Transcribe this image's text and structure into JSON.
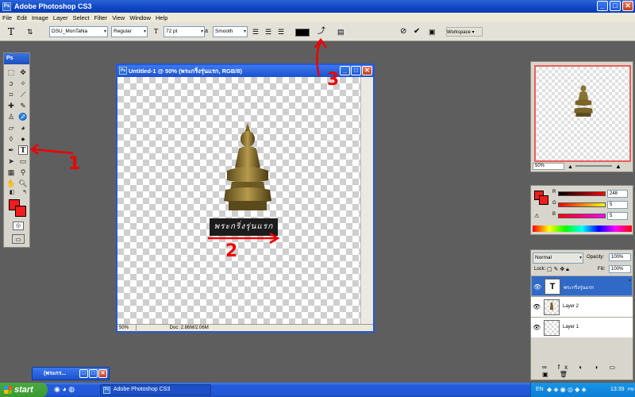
{
  "app": {
    "title": "Adobe Photoshop CS3",
    "icon_label": "Ps"
  },
  "menu": [
    "File",
    "Edit",
    "Image",
    "Layer",
    "Select",
    "Filter",
    "View",
    "Window",
    "Help"
  ],
  "options": {
    "font_family": "DSU_MonTaNa",
    "font_style": "Regular",
    "font_size": "72 pt",
    "anti_alias_label": "a",
    "anti_alias": "Smooth",
    "workspace": "Workspace"
  },
  "toolbox": {
    "header": "Ps"
  },
  "document": {
    "title": "Untitled-1 @ 50% (พระกริ่งรุ่นแรก, RGB/8)",
    "text_layer": "พระกริ่งรุ่นแรก",
    "zoom": "50%",
    "doc_size": "Doc: 2.86M/2.06M"
  },
  "navigator": {
    "zoom": "50%"
  },
  "color": {
    "r_label": "R",
    "g_label": "G",
    "b_label": "B",
    "r": "248",
    "g": "5",
    "b": "5",
    "r_fraction": 0.97,
    "g_fraction": 0.02,
    "b_fraction": 0.02,
    "foreground": "#f21d1d"
  },
  "layers": {
    "blend": "Normal",
    "opacity_label": "Opacity:",
    "opacity": "100%",
    "lock_label": "Lock:",
    "fill_label": "Fill:",
    "fill": "100%",
    "items": [
      {
        "name": "พระกริ่งรุ่นแรก",
        "thumb": "T",
        "selected": true
      },
      {
        "name": "Layer 2",
        "thumb": "",
        "selected": false
      },
      {
        "name": "Layer 1",
        "thumb": "",
        "selected": false
      }
    ]
  },
  "minimized_window": {
    "title": "(พระกร..."
  },
  "taskbar": {
    "start": "start",
    "item": "Adobe Photoshop CS3",
    "lang": "EN",
    "time": "13:39",
    "ampm": "PM"
  },
  "annotations": {
    "one": "1",
    "two": "2",
    "three": "3"
  }
}
